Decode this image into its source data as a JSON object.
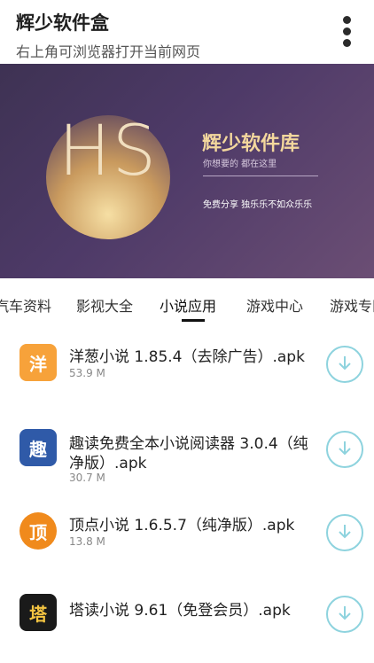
{
  "app": {
    "title": "辉少软件盒",
    "subtitle": "右上角可浏览器打开当前网页"
  },
  "banner": {
    "logo_text": "HS",
    "title": "辉少软件库",
    "tagline": "你想要的 都在这里",
    "slogan": "免费分享 独乐乐不如众乐乐"
  },
  "tabs": [
    "汽车资料",
    "影视大全",
    "小说应用",
    "游戏中心",
    "游戏专区"
  ],
  "active_tab": "小说应用",
  "items": [
    {
      "name": "洋葱小说 1.85.4（去除广告）.apk",
      "size": "53.9 M",
      "icon": "onion-novel-icon",
      "color": "#f7a23a"
    },
    {
      "name": "趣读免费全本小说阅读器 3.0.4（纯",
      "name2": "净版）.apk",
      "size": "30.7 M",
      "icon": "quread-icon",
      "color": "#2f5aa8"
    },
    {
      "name": "顶点小说 1.6.5.7（纯净版）.apk",
      "size": "13.8 M",
      "icon": "dingdian-icon",
      "color": "#f08a1c"
    },
    {
      "name": "塔读小说 9.61（免登会员）.apk",
      "size": "",
      "icon": "tadu-icon",
      "color": "#1a1a1a"
    }
  ],
  "icons": {
    "more": "more-vert-icon",
    "download": "download-circle-icon"
  },
  "colors": {
    "accent": "#8ed3de",
    "banner": "#4e3a68"
  }
}
